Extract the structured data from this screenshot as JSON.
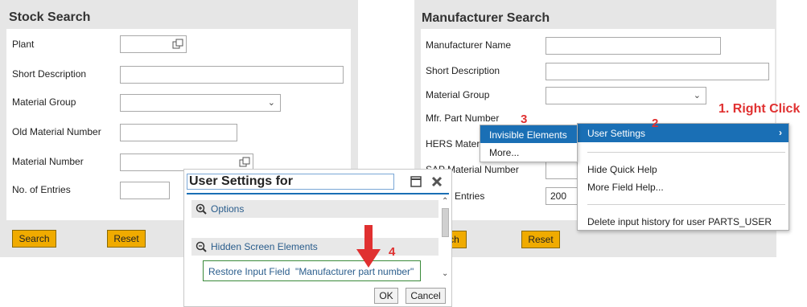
{
  "stock": {
    "title": "Stock Search",
    "plant": "Plant",
    "short_desc": "Short Description",
    "material_group": "Material Group",
    "old_material": "Old Material Number",
    "material_number": "Material Number",
    "entries": "No. of Entries",
    "search": "Search",
    "reset": "Reset"
  },
  "manufacturer": {
    "title": "Manufacturer Search",
    "name": "Manufacturer Name",
    "short_desc": "Short Description",
    "material_group": "Material Group",
    "mfr_part": "Mfr. Part Number",
    "hers": "HERS Mater",
    "sap": "SAP Material Number",
    "entries": "Entries",
    "entries_value": "200",
    "search": "rch",
    "reset": "Reset"
  },
  "context_menu": {
    "user_settings": "User Settings",
    "hide_help": "Hide Quick Help",
    "more_help": "More Field Help...",
    "delete_history": "Delete input history for user PARTS_USER"
  },
  "submenu": {
    "invisible": "Invisible Elements",
    "more": "More..."
  },
  "dialog": {
    "title": "User Settings for",
    "options": "Options",
    "hidden": "Hidden Screen Elements",
    "restore": "Restore Input Field  \"Manufacturer part number\"",
    "ok": "OK",
    "cancel": "Cancel"
  },
  "annotations": {
    "a1": "1. Right Click",
    "a2": "2",
    "a3": "3",
    "a4": "4"
  },
  "colors": {
    "highlight": "#1a6fb5",
    "button_yellow": "#f0ab00",
    "annotation_red": "#e03030",
    "dialog_link": "#2a5d8c"
  }
}
